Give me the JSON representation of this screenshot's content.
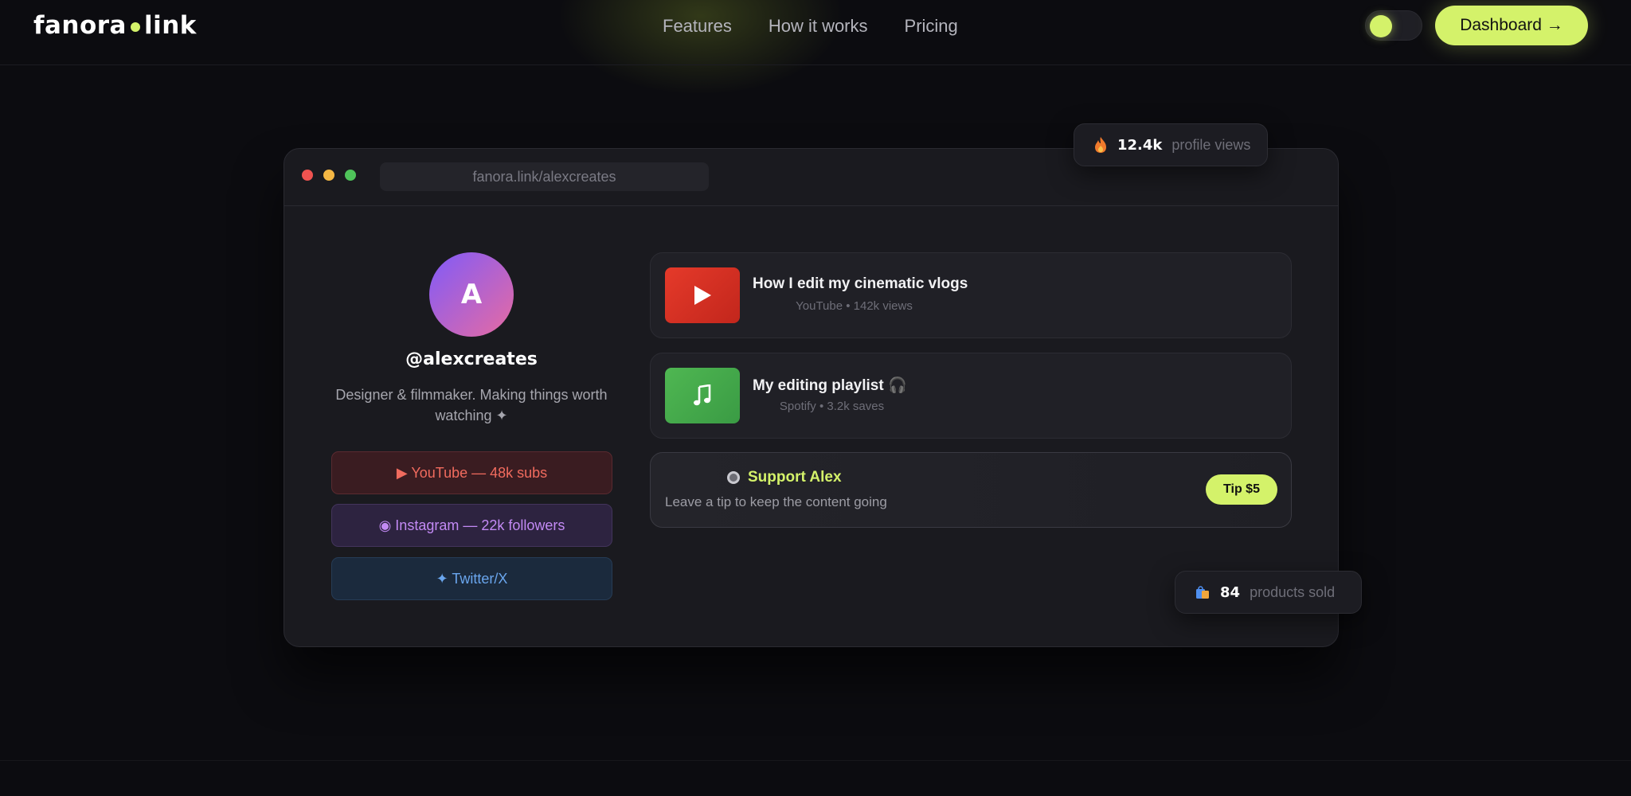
{
  "nav": {
    "logo_left": "fanora",
    "logo_right": "link",
    "links": [
      "Features",
      "How it works",
      "Pricing"
    ],
    "dashboard_label": "Dashboard →"
  },
  "window": {
    "url": "fanora.link/alexcreates"
  },
  "profile": {
    "avatar_letter": "A",
    "handle": "@alexcreates",
    "bio": "Designer & filmmaker. Making things worth watching ✦",
    "socials": [
      {
        "label": "▶ YouTube — 48k subs"
      },
      {
        "label": "◉ Instagram — 22k followers"
      },
      {
        "label": "✦ Twitter/X"
      }
    ]
  },
  "cards": [
    {
      "title": "How I edit my cinematic vlogs",
      "subtitle": "YouTube • 142k views"
    },
    {
      "title": "My editing playlist 🎧",
      "subtitle": "Spotify • 3.2k saves"
    }
  ],
  "support": {
    "title": "Support Alex",
    "subtitle": "Leave a tip to keep the content going",
    "tip_label": "Tip $5"
  },
  "badges": {
    "views_number": "12.4k",
    "views_label": "profile views",
    "sold_number": "84",
    "sold_label": "products sold"
  },
  "colors": {
    "accent": "#d4f26a",
    "background": "#0c0c10"
  }
}
